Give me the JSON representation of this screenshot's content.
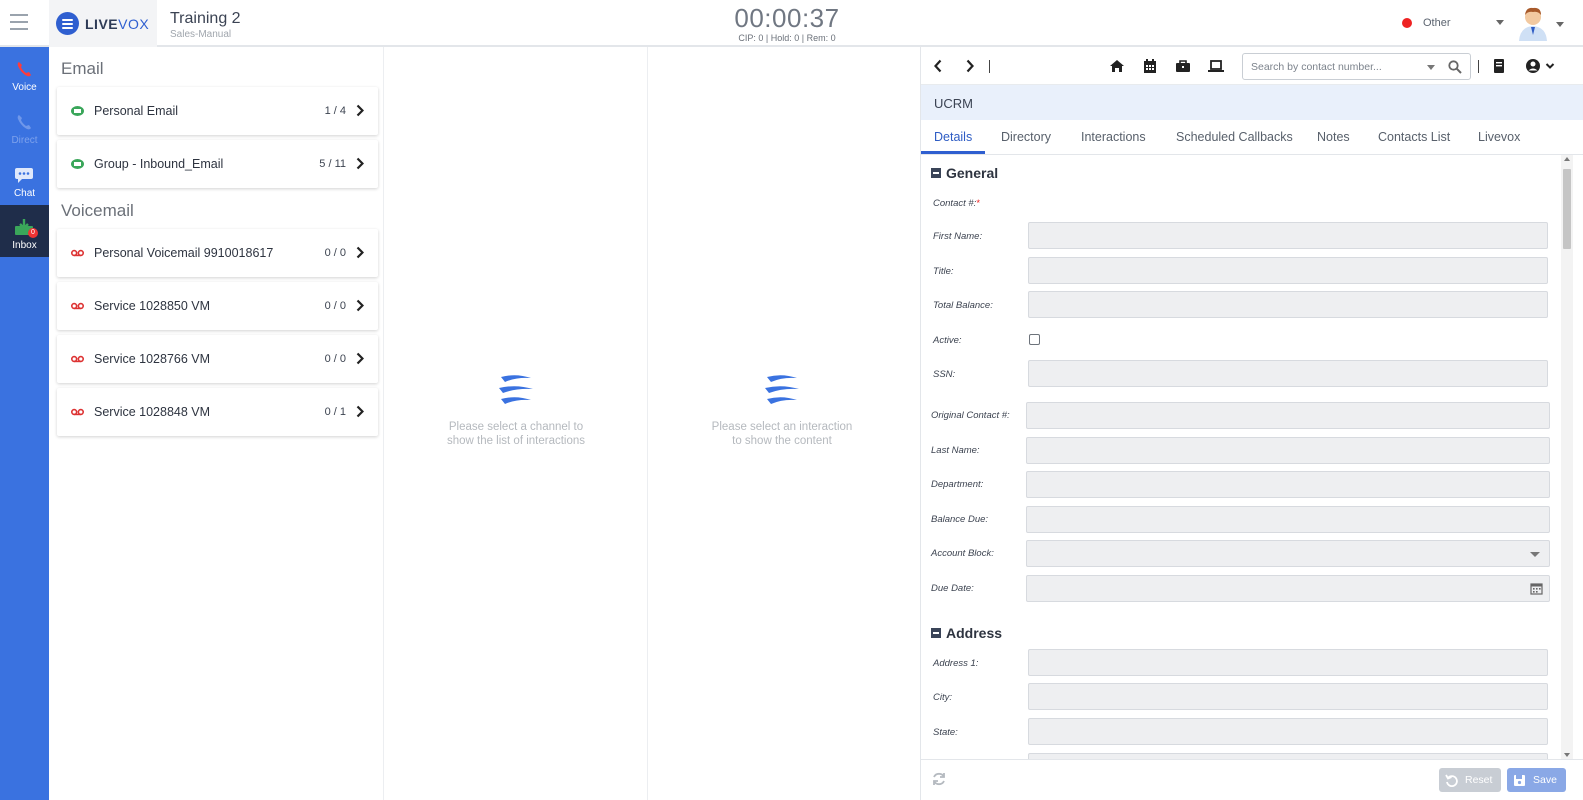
{
  "brand": {
    "name_bold": "LIVE",
    "name_light": "VOX"
  },
  "campaign": {
    "title": "Training 2",
    "subtitle": "Sales-Manual"
  },
  "timer": {
    "time": "00:00:37",
    "stats": "CIP: 0 | Hold: 0 | Rem: 0"
  },
  "agent_status": {
    "label": "Other",
    "color": "#ee2222"
  },
  "rail": {
    "items": [
      {
        "label": "Voice",
        "icon": "phone-icon"
      },
      {
        "label": "Direct",
        "icon": "phone-icon"
      },
      {
        "label": "Chat",
        "icon": "chat-icon"
      },
      {
        "label": "Inbox",
        "icon": "inbox-icon",
        "badge": "0"
      }
    ]
  },
  "channels": {
    "email_heading": "Email",
    "voicemail_heading": "Voicemail",
    "email": [
      {
        "name": "Personal Email",
        "count": "1 / 4"
      },
      {
        "name": "Group - Inbound_Email",
        "count": "5 / 11"
      }
    ],
    "voicemail": [
      {
        "name": "Personal Voicemail 9910018617",
        "count": "0 / 0"
      },
      {
        "name": "Service 1028850 VM",
        "count": "0 / 0"
      },
      {
        "name": "Service 1028766 VM",
        "count": "0 / 0"
      },
      {
        "name": "Service 1028848 VM",
        "count": "0 / 1"
      }
    ]
  },
  "interactions_panel": {
    "empty_line1": "Please select a channel to",
    "empty_line2": "show the list of interactions"
  },
  "content_panel": {
    "empty_line1": "Please select an interaction",
    "empty_line2": "to show the content"
  },
  "crm": {
    "search_placeholder": "Search by contact number...",
    "title": "UCRM",
    "tabs": [
      "Details",
      "Directory",
      "Interactions",
      "Scheduled Callbacks",
      "Notes",
      "Contacts List",
      "Livevox"
    ],
    "general_heading": "General",
    "address_heading": "Address",
    "labels": {
      "contact": "Contact #:",
      "first_name": "First Name:",
      "title": "Title:",
      "total_balance": "Total Balance:",
      "active": "Active:",
      "ssn": "SSN:",
      "original_contact": "Original Contact #:",
      "last_name": "Last Name:",
      "department": "Department:",
      "balance_due": "Balance Due:",
      "account_block": "Account Block:",
      "due_date": "Due Date:",
      "address1": "Address 1:",
      "city": "City:",
      "state": "State:"
    },
    "reset_label": "Reset",
    "save_label": "Save"
  },
  "colors": {
    "rail": "#3a72e0",
    "accent": "#2f5fd0",
    "rail_active": "#1f2d4a"
  }
}
